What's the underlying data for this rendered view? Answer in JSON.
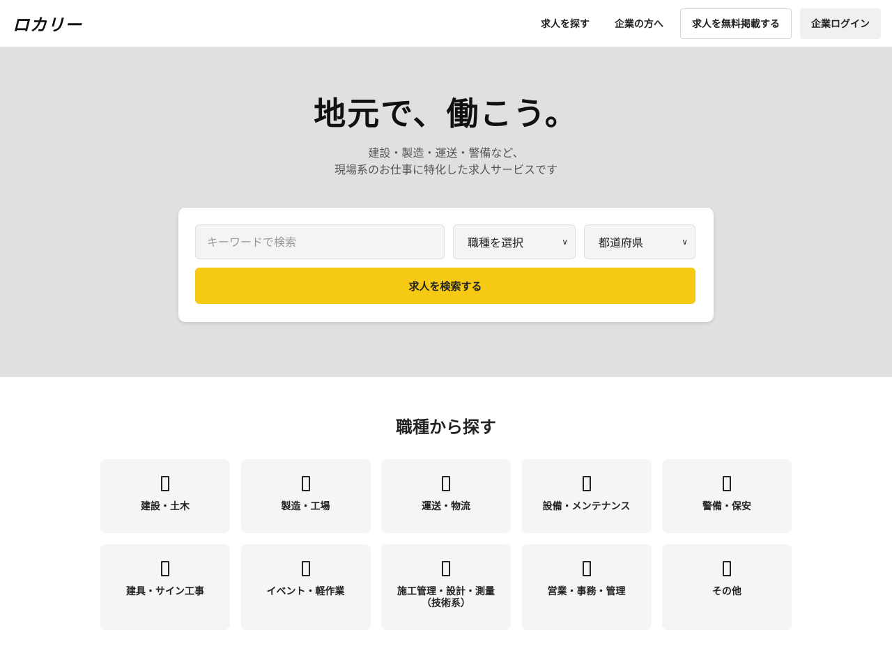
{
  "header": {
    "logo": "ロカリー",
    "nav": {
      "find_jobs": "求人を探す",
      "for_companies": "企業の方へ",
      "post_free": "求人を無料掲載する",
      "company_login": "企業ログイン"
    }
  },
  "hero": {
    "title": "地元で、働こう。",
    "subtitle_line1": "建設・製造・運送・警備など、",
    "subtitle_line2": "現場系のお仕事に特化した求人サービスです"
  },
  "search": {
    "keyword_placeholder": "キーワードで検索",
    "job_type_selected": "職種を選択",
    "prefecture_selected": "都道府県",
    "submit_label": "求人を検索する"
  },
  "categories": {
    "title": "職種から探す",
    "items": [
      {
        "label": "建設・土木",
        "icon": "tofu-placeholder-icon"
      },
      {
        "label": "製造・工場",
        "icon": "tofu-placeholder-icon"
      },
      {
        "label": "運送・物流",
        "icon": "tofu-placeholder-icon"
      },
      {
        "label": "設備・メンテナンス",
        "icon": "tofu-placeholder-icon"
      },
      {
        "label": "警備・保安",
        "icon": "tofu-placeholder-icon"
      },
      {
        "label": "建具・サイン工事",
        "icon": "tofu-placeholder-icon"
      },
      {
        "label": "イベント・軽作業",
        "icon": "tofu-placeholder-icon"
      },
      {
        "label": "施工管理・設計・測量（技術系）",
        "icon": "tofu-placeholder-icon"
      },
      {
        "label": "営業・事務・管理",
        "icon": "tofu-placeholder-icon"
      },
      {
        "label": "その他",
        "icon": "tofu-placeholder-icon"
      }
    ]
  },
  "colors": {
    "accent": "#f6c915",
    "hero_bg": "#e0e0e0",
    "card_bg": "#f5f5f5"
  }
}
